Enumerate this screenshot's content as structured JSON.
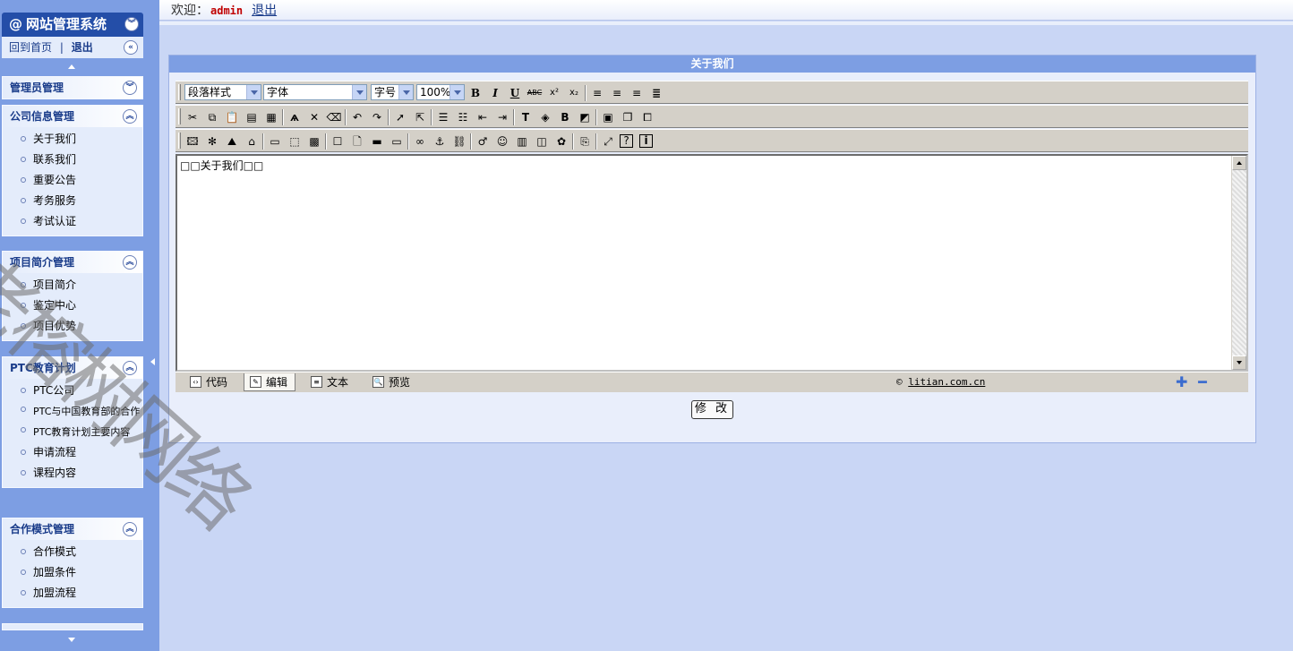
{
  "sidebar": {
    "title": "网站管理系统",
    "title_icon": "@",
    "home_link": "回到首页",
    "separator": "|",
    "logout_link": "退出",
    "groups": [
      {
        "title": "管理员管理",
        "state": "collapsed",
        "items": []
      },
      {
        "title": "公司信息管理",
        "state": "expanded",
        "items": [
          "关于我们",
          "联系我们",
          "重要公告",
          "考务服务",
          "考试认证"
        ]
      },
      {
        "title": "项目简介管理",
        "state": "expanded",
        "items": [
          "项目简介",
          "鉴定中心",
          "项目优势"
        ]
      },
      {
        "title": "PTC教育计划",
        "state": "expanded",
        "items": [
          "PTC公司",
          "PTC与中国教育部的合作",
          "PTC教育计划主要内容",
          "申请流程",
          "课程内容"
        ]
      },
      {
        "title": "合作模式管理",
        "state": "expanded",
        "items": [
          "合作模式",
          "加盟条件",
          "加盟流程"
        ]
      }
    ]
  },
  "header": {
    "welcome": "欢迎：",
    "username": "admin",
    "logout": "退出"
  },
  "panel": {
    "title": "关于我们",
    "toolbar": {
      "paragraph_style": "段落样式",
      "font": "字体",
      "font_size": "字号",
      "zoom": "100%"
    },
    "editor_content": "□□关于我们□□",
    "modes": [
      "代码",
      "编辑",
      "文本",
      "预览"
    ],
    "active_mode": "编辑",
    "copyright_symbol": "©",
    "copyright_link": "litian.com.cn",
    "submit": "修 改"
  },
  "watermark": "老榕树网络",
  "colors": {
    "sidebar_bg": "#7d9ee3",
    "sidebar_title_bg": "#244ea8",
    "page_bg": "#c9d6f5",
    "panel_title_bg": "#7d9ee3",
    "toolbar_bg": "#d4d0c8",
    "username_color": "#c00000"
  }
}
